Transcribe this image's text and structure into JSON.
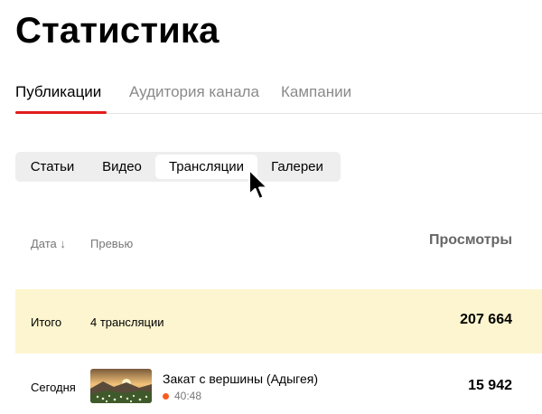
{
  "page": {
    "title": "Статистика"
  },
  "tabs": [
    {
      "label": "Публикации",
      "active": true
    },
    {
      "label": "Аудитория канала",
      "active": false
    },
    {
      "label": "Кампании",
      "active": false
    }
  ],
  "content_types": [
    {
      "label": "Статьи",
      "active": false
    },
    {
      "label": "Видео",
      "active": false
    },
    {
      "label": "Трансляции",
      "active": true
    },
    {
      "label": "Галереи",
      "active": false
    }
  ],
  "table": {
    "columns": {
      "date": "Дата ↓",
      "preview": "Превью",
      "views": "Просмотры"
    },
    "total": {
      "label": "Итого",
      "count": "4 трансляции",
      "views": "207 664"
    },
    "rows": [
      {
        "date": "Сегодня",
        "title": "Закат с вершины (Адыгея)",
        "duration": "40:48",
        "views": "15 942",
        "live": true
      }
    ]
  },
  "colors": {
    "accent": "#e11c1c",
    "total_bg": "#fdf5cf",
    "segment_bg": "#eeeeee",
    "live_dot": "#ff5a1f"
  }
}
